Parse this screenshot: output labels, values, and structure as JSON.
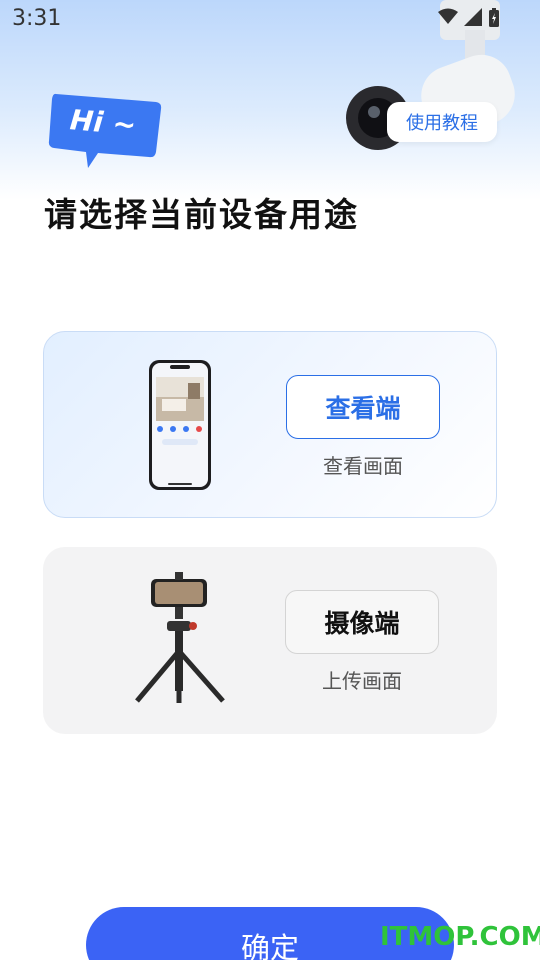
{
  "status_bar": {
    "time": "3:31"
  },
  "header": {
    "greeting": "Hi ~",
    "tutorial_label": "使用教程",
    "title": "请选择当前设备用途"
  },
  "options": [
    {
      "label": "查看端",
      "description": "查看画面",
      "selected": true
    },
    {
      "label": "摄像端",
      "description": "上传画面",
      "selected": false
    }
  ],
  "footer": {
    "confirm_label": "确定"
  },
  "watermark": "ITMOP.COM",
  "colors": {
    "accent": "#2b6fe6",
    "confirm": "#3b63f5",
    "watermark": "#2fc33a"
  }
}
